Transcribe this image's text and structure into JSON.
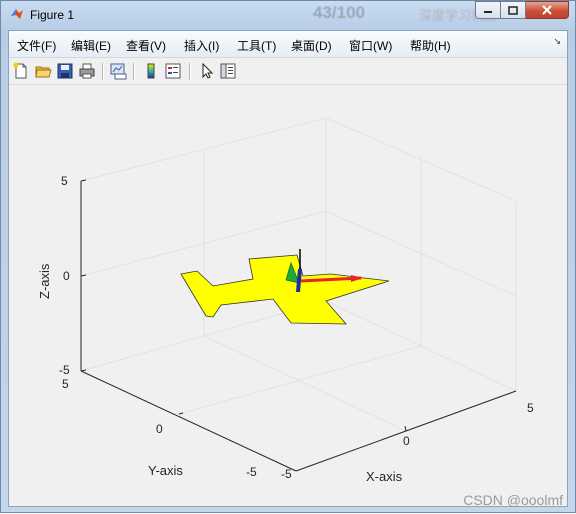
{
  "window": {
    "title": "Figure 1",
    "ghost_text": "43/100",
    "ghost_text2": "深度学习机器"
  },
  "menu": {
    "items": [
      {
        "label": "文件(F)"
      },
      {
        "label": "编辑(E)"
      },
      {
        "label": "查看(V)"
      },
      {
        "label": "插入(I)"
      },
      {
        "label": "工具(T)"
      },
      {
        "label": "桌面(D)"
      },
      {
        "label": "窗口(W)"
      },
      {
        "label": "帮助(H)"
      }
    ],
    "overflow_icon": "double-chevron-icon"
  },
  "toolbar": {
    "icons": [
      "new-file-icon",
      "open-folder-icon",
      "save-icon",
      "print-icon",
      "link-plot-icon",
      "colorbar-icon",
      "legend-icon",
      "pointer-icon",
      "property-inspector-icon"
    ]
  },
  "axes": {
    "xlabel": "X-axis",
    "ylabel": "Y-axis",
    "zlabel": "Z-axis",
    "x_ticks": [
      "-5",
      "0",
      "5"
    ],
    "y_ticks": [
      "-5",
      "0",
      "5"
    ],
    "z_ticks": [
      "-5",
      "0",
      "5"
    ],
    "xlim": [
      -5,
      5
    ],
    "ylim": [
      -5,
      5
    ],
    "zlim": [
      -5,
      5
    ],
    "grid": true,
    "view": "3D"
  },
  "colors": {
    "aircraft": "#ffff00",
    "x_arrow": "#e8242a",
    "y_arrow": "#1fa83a",
    "z_arrow": "#1e2aa8",
    "vertical_line": "#000000"
  },
  "watermark": "CSDN @ooolmf"
}
